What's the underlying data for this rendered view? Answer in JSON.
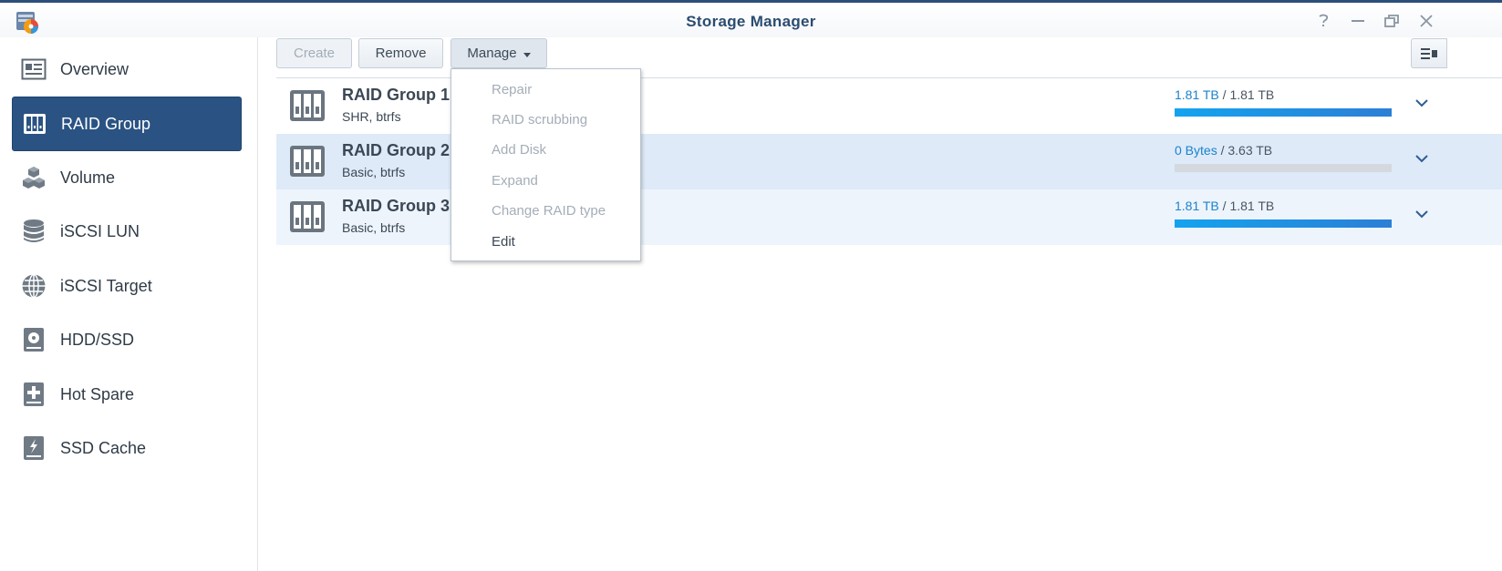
{
  "window": {
    "title": "Storage Manager",
    "controls": [
      "help-icon",
      "minimize-icon",
      "restore-icon",
      "close-icon"
    ]
  },
  "sidebar": {
    "items": [
      {
        "label": "Overview",
        "icon": "overview-icon",
        "active": false
      },
      {
        "label": "RAID Group",
        "icon": "raid-group-icon",
        "active": true
      },
      {
        "label": "Volume",
        "icon": "volume-icon",
        "active": false
      },
      {
        "label": "iSCSI LUN",
        "icon": "database-icon",
        "active": false
      },
      {
        "label": "iSCSI Target",
        "icon": "globe-icon",
        "active": false
      },
      {
        "label": "HDD/SSD",
        "icon": "hdd-icon",
        "active": false
      },
      {
        "label": "Hot Spare",
        "icon": "hot-spare-icon",
        "active": false
      },
      {
        "label": "SSD Cache",
        "icon": "ssd-cache-icon",
        "active": false
      }
    ]
  },
  "toolbar": {
    "create_label": "Create",
    "remove_label": "Remove",
    "manage_label": "Manage"
  },
  "raid_groups": [
    {
      "name": "RAID Group 1",
      "desc": "SHR, btrfs",
      "used": "1.81 TB",
      "total": "1.81 TB",
      "fill": 1.0
    },
    {
      "name": "RAID Group 2",
      "desc": "Basic, btrfs",
      "used": "0 Bytes",
      "total": "3.63 TB",
      "fill": 0.0
    },
    {
      "name": "RAID Group 3",
      "desc": "Basic, btrfs",
      "used": "1.81 TB",
      "total": "1.81 TB",
      "fill": 1.0
    }
  ],
  "manage_menu": {
    "items": [
      {
        "label": "Repair",
        "enabled": false
      },
      {
        "label": "RAID scrubbing",
        "enabled": false
      },
      {
        "label": "Add Disk",
        "enabled": false
      },
      {
        "label": "Expand",
        "enabled": false
      },
      {
        "label": "Change RAID type",
        "enabled": false
      },
      {
        "label": "Edit",
        "enabled": true
      }
    ]
  },
  "colors": {
    "accent": "#2a5383",
    "usage_used": "#1a83cc",
    "row_selected": "#deeaf8",
    "row_alt": "#edf4fc"
  }
}
